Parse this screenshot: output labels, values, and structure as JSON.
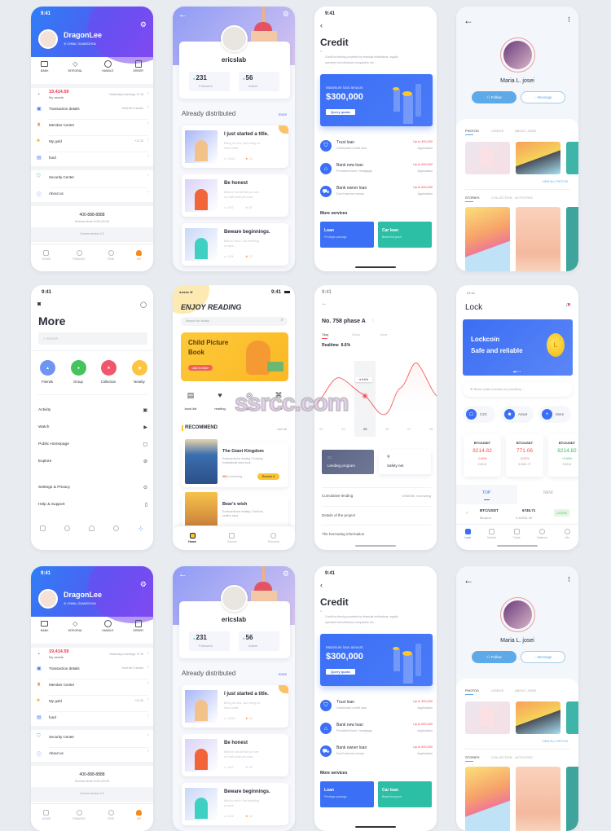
{
  "watermark": "ssrcc.com",
  "status_time": "9:41",
  "profile1": {
    "name": "DragonLee",
    "location": "CHINA, GUANGZHOU",
    "shortcuts": [
      "BANK",
      "INTEGRAL",
      "HANDLE",
      "ORDER"
    ],
    "assets_value": "19,414.59",
    "assets_label": "My assets",
    "assets_note": "Yesterday's earnings +2.16",
    "items": [
      {
        "label": "Transaction details",
        "note": "Hold the 3 stroke"
      },
      {
        "label": "Member Center",
        "note": ""
      },
      {
        "label": "My gold",
        "note": "+12.33"
      },
      {
        "label": "fund",
        "note": ""
      },
      {
        "label": "Security Center",
        "note": ""
      },
      {
        "label": "About us",
        "note": ""
      }
    ],
    "phone": "400-888-8888",
    "service_time": "Service time 9:00-20:00",
    "version": "Current version 2.0",
    "nav": [
      "HOME",
      "FINANCE",
      "FIND",
      "MY"
    ],
    "accent": "#3a6ff7"
  },
  "profile2": {
    "name": "ericslab",
    "followers": "231",
    "followers_label": "Followers",
    "articles": "56",
    "articles_label": "Article",
    "section": "Already distributed",
    "more": "more",
    "posts": [
      {
        "title": "I just started a title.",
        "desc1": "Being on sea, sail; being on",
        "desc2": "land, settle.",
        "comments": "1312",
        "stars": "21"
      },
      {
        "title": "Be honest",
        "desc1": "Believe not all that you see",
        "desc2": "nor half what you hear.",
        "comments": "422",
        "stars": "87"
      },
      {
        "title": "Beware beginnings.",
        "desc1": "Birth is much, but breeding",
        "desc2": "is more.",
        "comments": "124",
        "stars": "12"
      }
    ]
  },
  "credit": {
    "title": "Credit",
    "quote": "Credit is directly provided by financial institutions, legally",
    "quote2": "operated microfinance companies etc.",
    "card_label": "Maximum loan amount",
    "card_amount": "$300,000",
    "card_button": "Query quota",
    "loans": [
      {
        "name": "Trust loan",
        "desc": "Unsecured credit loan",
        "limit": "Up to 300,000",
        "action": "Application"
      },
      {
        "name": "Bank new loan",
        "desc": "Provident fund / mortgage",
        "limit": "Up to 500,000",
        "action": "Application"
      },
      {
        "name": "Bank owner loan",
        "desc": "Don't borrow money",
        "limit": "Up to 500,000",
        "action": "Application"
      }
    ],
    "more_services": "More services",
    "services": [
      {
        "name": "Loan",
        "desc": "Privilege package"
      },
      {
        "name": "Car loan",
        "desc": "Brand hot push"
      }
    ]
  },
  "maria": {
    "name": "Maria L. josei",
    "follow": "Follow",
    "message": "Message",
    "tabs1": [
      "PHOTOS",
      "VIDEOS",
      "ABOUT JOSEI"
    ],
    "view_all": "VIEW ALL PHOTOS",
    "tabs2": [
      "STORIES",
      "COLLECTION",
      "ACTIVITIES"
    ]
  },
  "more": {
    "title": "More",
    "search_placeholder": "Search",
    "circles": [
      {
        "label": "Friends",
        "color": "#6f95f2"
      },
      {
        "label": "Group",
        "color": "#45c35d"
      },
      {
        "label": "Collection",
        "color": "#f2566a"
      },
      {
        "label": "Nearby",
        "color": "#fbc540"
      }
    ],
    "items": [
      "Activity",
      "Watch",
      "Public Homepage",
      "Explore"
    ],
    "items2": [
      "Settings & Privacy",
      "Help & Support"
    ]
  },
  "reading": {
    "title": "ENJOY READING",
    "search_placeholder": "Search for books",
    "banner_title1": "Child Picture",
    "banner_title2": "Book",
    "banner_button": "click to enter",
    "icons": [
      "book list",
      "reading",
      "space",
      "more"
    ],
    "recommend": "RECOMMEND",
    "see_all": "see all",
    "books": [
      {
        "title": "The Giant Kingdom",
        "desc1": "Extracurricular reading / Growing",
        "desc2": "motivational story book",
        "remaining": "261",
        "remaining_label": "remaining",
        "button": "Borrow it"
      },
      {
        "title": "Bear's wish",
        "desc1": "Extracurricular reading / Child ed-",
        "desc2": "ucation story"
      }
    ],
    "nav": [
      "Home",
      "Borrow",
      "Personal"
    ],
    "accent": "#fbc531"
  },
  "project": {
    "title": "No. 758 phase A",
    "tabs": [
      "7day",
      "30day",
      "1year"
    ],
    "realtime_label": "Realtime",
    "realtime_value": "8.6%",
    "tooltip": "8.6%",
    "days": [
      "03",
      "04",
      "05",
      "06",
      "07",
      "08"
    ],
    "btn1": "Lending program",
    "btn2": "Safety net",
    "rows": [
      {
        "label": "Cumulative lending",
        "value": "6788356",
        "unit": "borrowing"
      },
      {
        "label": "Details of the project"
      },
      {
        "label": "The borrowing information"
      }
    ]
  },
  "lock": {
    "time": "21:11",
    "title": "Lock",
    "banner1": "Lockcoin",
    "banner2": "Safe and reliable",
    "search_placeholder": "Block chain industry is promising ...",
    "chips": [
      "C2C",
      "Asset",
      "More"
    ],
    "tickers": [
      {
        "pair": "BTC/USDT",
        "price": "8214.82",
        "change": "-0.60%",
        "cny": "¥ 8214",
        "color": "#f2564d"
      },
      {
        "pair": "BTC/USDT",
        "price": "771.06",
        "change": "-5.57%",
        "cny": "¥ 6961.77",
        "color": "#f2564d"
      },
      {
        "pair": "BTC/USDT",
        "price": "8214.82",
        "change": "+0.60%",
        "cny": "¥ 8214",
        "color": "#3dbb5c"
      }
    ],
    "tabs": [
      "TOP",
      "NEW"
    ],
    "row": {
      "pair": "BTC/USDT",
      "exchange": "Binance",
      "price": "6745.71",
      "cny": "¥ 44034.39",
      "change": "-0.21%"
    },
    "nav": [
      "Lock",
      "Market",
      "Trade",
      "Balance",
      "Me"
    ]
  }
}
